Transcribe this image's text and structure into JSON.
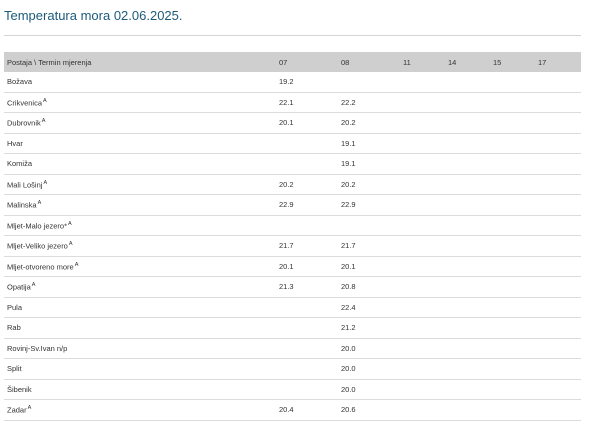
{
  "page": {
    "title": "Temperatura mora 02.06.2025."
  },
  "table": {
    "headers": [
      "Postaja \\ Termin mjerenja",
      "07",
      "08",
      "11",
      "14",
      "15",
      "17"
    ],
    "rows": [
      {
        "station": "Božava",
        "mark": "",
        "t07": "19.2",
        "t08": "",
        "t11": "",
        "t14": "",
        "t15": "",
        "t17": ""
      },
      {
        "station": "Crikvenica",
        "mark": "A",
        "t07": "22.1",
        "t08": "22.2",
        "t11": "",
        "t14": "",
        "t15": "",
        "t17": ""
      },
      {
        "station": "Dubrovnik",
        "mark": "A",
        "t07": "20.1",
        "t08": "20.2",
        "t11": "",
        "t14": "",
        "t15": "",
        "t17": ""
      },
      {
        "station": "Hvar",
        "mark": "",
        "t07": "",
        "t08": "19.1",
        "t11": "",
        "t14": "",
        "t15": "",
        "t17": ""
      },
      {
        "station": "Komiža",
        "mark": "",
        "t07": "",
        "t08": "19.1",
        "t11": "",
        "t14": "",
        "t15": "",
        "t17": ""
      },
      {
        "station": "Mali Lošinj",
        "mark": "A",
        "t07": "20.2",
        "t08": "20.2",
        "t11": "",
        "t14": "",
        "t15": "",
        "t17": ""
      },
      {
        "station": "Malinska",
        "mark": "A",
        "t07": "22.9",
        "t08": "22.9",
        "t11": "",
        "t14": "",
        "t15": "",
        "t17": ""
      },
      {
        "station": "Mljet-Malo jezero*",
        "mark": "A",
        "t07": "",
        "t08": "",
        "t11": "",
        "t14": "",
        "t15": "",
        "t17": ""
      },
      {
        "station": "Mljet-Veliko jezero",
        "mark": "A",
        "t07": "21.7",
        "t08": "21.7",
        "t11": "",
        "t14": "",
        "t15": "",
        "t17": ""
      },
      {
        "station": "Mljet-otvoreno more",
        "mark": "A",
        "t07": "20.1",
        "t08": "20.1",
        "t11": "",
        "t14": "",
        "t15": "",
        "t17": ""
      },
      {
        "station": "Opatija",
        "mark": "A",
        "t07": "21.3",
        "t08": "20.8",
        "t11": "",
        "t14": "",
        "t15": "",
        "t17": ""
      },
      {
        "station": "Pula",
        "mark": "",
        "t07": "",
        "t08": "22.4",
        "t11": "",
        "t14": "",
        "t15": "",
        "t17": ""
      },
      {
        "station": "Rab",
        "mark": "",
        "t07": "",
        "t08": "21.2",
        "t11": "",
        "t14": "",
        "t15": "",
        "t17": ""
      },
      {
        "station": "Rovinj-Sv.Ivan n/p",
        "mark": "",
        "t07": "",
        "t08": "20.0",
        "t11": "",
        "t14": "",
        "t15": "",
        "t17": ""
      },
      {
        "station": "Split",
        "mark": "",
        "t07": "",
        "t08": "20.0",
        "t11": "",
        "t14": "",
        "t15": "",
        "t17": ""
      },
      {
        "station": "Šibenik",
        "mark": "",
        "t07": "",
        "t08": "20.0",
        "t11": "",
        "t14": "",
        "t15": "",
        "t17": ""
      },
      {
        "station": "Zadar",
        "mark": "A",
        "t07": "20.4",
        "t08": "20.6",
        "t11": "",
        "t14": "",
        "t15": "",
        "t17": ""
      }
    ]
  }
}
